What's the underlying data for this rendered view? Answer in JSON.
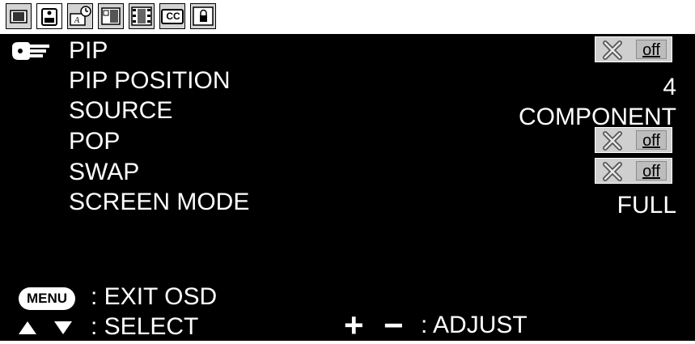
{
  "tabs": [
    {
      "icon": "display-icon"
    },
    {
      "icon": "audio-icon"
    },
    {
      "icon": "timer-icon"
    },
    {
      "icon": "pip-icon"
    },
    {
      "icon": "film-icon"
    },
    {
      "icon": "cc-icon",
      "label": "CC"
    },
    {
      "icon": "lock-icon"
    }
  ],
  "menu": {
    "items": [
      {
        "label": "PIP",
        "value": "off",
        "type": "toggle"
      },
      {
        "label": "PIP POSITION",
        "value": "4",
        "type": "text"
      },
      {
        "label": "SOURCE",
        "value": "COMPONENT",
        "type": "text"
      },
      {
        "label": "POP",
        "value": "off",
        "type": "toggle"
      },
      {
        "label": "SWAP",
        "value": "off",
        "type": "toggle"
      },
      {
        "label": "SCREEN MODE",
        "value": "FULL",
        "type": "text"
      }
    ]
  },
  "footer": {
    "menu_key": "MENU",
    "exit_text": ": EXIT OSD",
    "select_text": ": SELECT",
    "plus": "+",
    "minus": "−",
    "adjust_text": ": ADJUST"
  },
  "colors": {
    "background": "#000000",
    "text": "#ffffff",
    "toggle_bg": "#cfcfcf"
  }
}
